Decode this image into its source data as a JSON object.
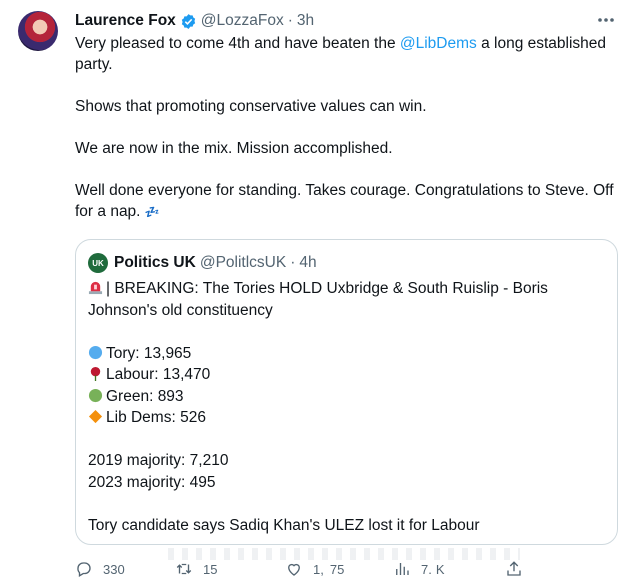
{
  "tweet": {
    "author_name": "Laurence Fox",
    "handle": "@LozzaFox",
    "separator": "·",
    "time": "3h",
    "more_icon": "more-horizontal-icon",
    "lines": {
      "l1_pre": "Very pleased to come 4th and have beaten the ",
      "l1_link": "@LibDems",
      "l1_post": " a long established party.",
      "l2": "Shows that promoting conservative values can win.",
      "l3": "We are now in the mix. Mission accomplished.",
      "l4": "Well done everyone for standing. Takes courage. Congratulations to Steve. Off for a nap.",
      "l4_emoji": "💤"
    }
  },
  "quote": {
    "author_name": "Politics UK",
    "avatar_text": "UK",
    "handle": "@PolitlcsUK",
    "separator": "·",
    "time": "4h",
    "headline": "| BREAKING: The Tories HOLD Uxbridge & South Ruislip - Boris Johnson's old constituency",
    "results": [
      {
        "party": "Tory: 13,965",
        "icon": "blue-circle-icon",
        "color": "#55acee"
      },
      {
        "party": "Labour: 13,470",
        "icon": "red-rose-icon",
        "color": "#be1931"
      },
      {
        "party": "Green: 893",
        "icon": "green-circle-icon",
        "color": "#78b159"
      },
      {
        "party": "Lib Dems: 526",
        "icon": "orange-diamond-icon",
        "color": "#f4900c"
      }
    ],
    "majority_2019": "2019 majority: 7,210",
    "majority_2023": "2023 majority: 495",
    "footer_line": "Tory candidate says Sadiq Khan's ULEZ lost it for Labour"
  },
  "actions": {
    "replies": "330",
    "retweets": "15",
    "likes": "1,",
    "likes_suffix": "75",
    "views": "7.",
    "views_suffix": "K"
  },
  "colors": {
    "accent": "#1d9bf0",
    "text": "#0f1419",
    "muted": "#536471",
    "border": "#cfd9de"
  }
}
